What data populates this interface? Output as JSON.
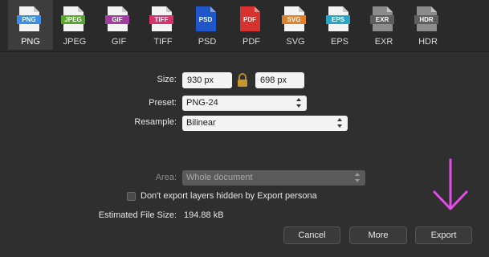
{
  "formats": [
    {
      "tag": "PNG",
      "name": "PNG",
      "color": "#3a8ee6",
      "selected": true
    },
    {
      "tag": "JPEG",
      "name": "JPEG",
      "color": "#5aa52b"
    },
    {
      "tag": "GIF",
      "name": "GIF",
      "color": "#a23ea0"
    },
    {
      "tag": "TIFF",
      "name": "TIFF",
      "color": "#d8336d"
    },
    {
      "tag": "PSD",
      "name": "PSD",
      "color": "#1f57c8",
      "full": true
    },
    {
      "tag": "PDF",
      "name": "PDF",
      "color": "#d6322f",
      "full": true
    },
    {
      "tag": "SVG",
      "name": "SVG",
      "color": "#e0812a"
    },
    {
      "tag": "EPS",
      "name": "EPS",
      "color": "#2aa6c4"
    },
    {
      "tag": "EXR",
      "name": "EXR",
      "color": "#7a7a7a",
      "dark": true
    },
    {
      "tag": "HDR",
      "name": "HDR",
      "color": "#7a7a7a",
      "dark": true
    }
  ],
  "size": {
    "label": "Size:",
    "width": "930 px",
    "height": "698 px"
  },
  "preset": {
    "label": "Preset:",
    "value": "PNG-24"
  },
  "resample": {
    "label": "Resample:",
    "value": "Bilinear"
  },
  "area": {
    "label": "Area:",
    "value": "Whole document"
  },
  "hidden_layers": {
    "label": "Don't export layers hidden by Export persona",
    "checked": false
  },
  "estimate": {
    "label": "Estimated File Size:",
    "value": "194.88 kB"
  },
  "buttons": {
    "cancel": "Cancel",
    "more": "More",
    "export": "Export"
  },
  "annotation": {
    "arrow_color": "#e14ee6"
  }
}
